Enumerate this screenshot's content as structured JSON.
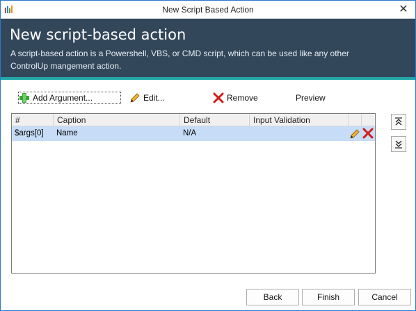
{
  "window": {
    "title": "New Script Based Action",
    "close_glyph": "✕"
  },
  "header": {
    "title": "New script-based action",
    "description": "A script-based action is a Powershell, VBS, or CMD script, which can be used like any other ControlUp mangement action."
  },
  "toolbar": {
    "add_label": "Add Argument...",
    "edit_label": "Edit...",
    "remove_label": "Remove",
    "preview_label": "Preview"
  },
  "grid": {
    "columns": [
      "#",
      "Caption",
      "Default",
      "Input Validation"
    ],
    "rows": [
      {
        "index": "$args[0]",
        "caption": "Name",
        "default": "N/A",
        "input_validation": ""
      }
    ]
  },
  "side_buttons": {
    "up_icon": "move-up-icon",
    "down_icon": "move-down-icon"
  },
  "footer": {
    "back_label": "Back",
    "finish_label": "Finish",
    "cancel_label": "Cancel"
  },
  "colors": {
    "header_bg": "#33475b",
    "accent": "#21a7a9",
    "selected_row": "#c7dcf6"
  }
}
